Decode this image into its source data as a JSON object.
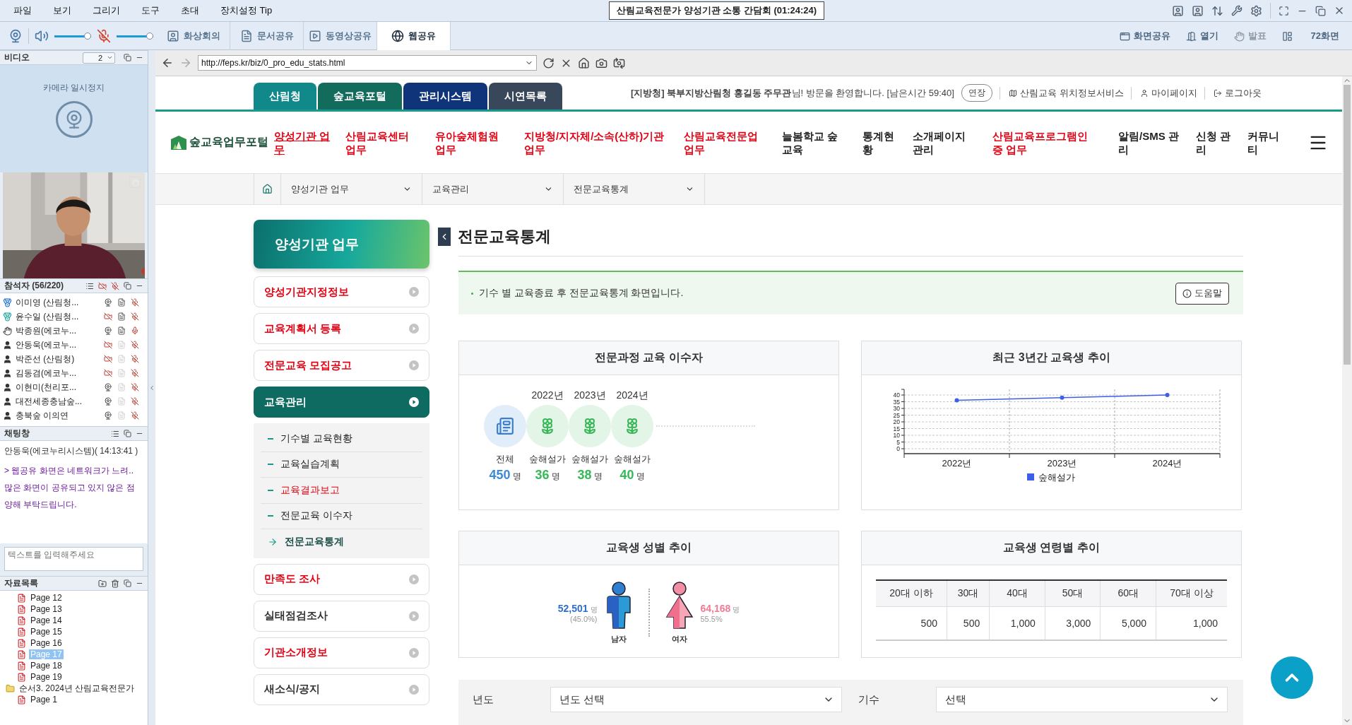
{
  "menu": [
    "파일",
    "보기",
    "그리기",
    "도구",
    "초대",
    "장치설정 Tip"
  ],
  "title": "산림교육전문가 양성기관 소통 간담회 (01:24:24)",
  "audio": {
    "speaker": {
      "level": 1
    },
    "mic": {
      "level": 1,
      "muted": true
    }
  },
  "tabs": [
    {
      "label": "화상회의",
      "kind": "person",
      "selected": false
    },
    {
      "label": "문서공유",
      "kind": "document",
      "selected": false
    },
    {
      "label": "동영상공유",
      "kind": "video",
      "selected": false
    },
    {
      "label": "웹공유",
      "kind": "web",
      "selected": true
    }
  ],
  "tools": [
    {
      "label": "화면공유",
      "kind": "screen",
      "disabled": false
    },
    {
      "label": "열기",
      "kind": "open",
      "disabled": false
    },
    {
      "label": "발표",
      "kind": "hand",
      "disabled": true
    },
    {
      "label": "72화면",
      "kind": "layout",
      "disabled": false
    }
  ],
  "video": {
    "title": "비디오",
    "count": "2",
    "camera_status": "카메라 일시정지"
  },
  "participants": {
    "title": "참석자 (56/220)",
    "items": [
      {
        "name": "이미영 (산림청...",
        "kind": "host",
        "camera": true,
        "document": true,
        "mic": false
      },
      {
        "name": "윤수일 (산림청...",
        "kind": "cohost",
        "camera": false,
        "document": true,
        "mic": false
      },
      {
        "name": "박종원(에코누...",
        "kind": "hand",
        "camera": true,
        "document": true,
        "mic": true
      },
      {
        "name": "안동욱(에코누...",
        "kind": "user",
        "camera": false,
        "document": false,
        "mic": false
      },
      {
        "name": "박준선 (산림청)",
        "kind": "user",
        "camera": false,
        "document": false,
        "mic": false
      },
      {
        "name": "김동겸(에코누...",
        "kind": "user",
        "camera": false,
        "document": false,
        "mic": false
      },
      {
        "name": "이현미(천리포...",
        "kind": "user",
        "camera": true,
        "document": false,
        "mic": false
      },
      {
        "name": "대전세종충남숲...",
        "kind": "user",
        "camera": true,
        "document": false,
        "mic": false
      },
      {
        "name": "충북숲 이의연",
        "kind": "user",
        "camera": true,
        "document": false,
        "mic": false
      }
    ]
  },
  "chat": {
    "title": "채팅창",
    "messages": [
      {
        "kind": "sender",
        "text": "안동욱(에코누리시스템)( 14:13:41 )"
      },
      {
        "kind": "message",
        "text": "> 웹공유 화면은 네트워크가 느려.. 많은 화면이 공유되고 있지 않은 점 양해 부탁드립니다."
      }
    ],
    "placeholder": "텍스트를 입력해주세요"
  },
  "documents": {
    "title": "자료목록",
    "items": [
      {
        "label": "Page 12",
        "kind": "page",
        "selected": false
      },
      {
        "label": "Page 13",
        "kind": "page",
        "selected": false
      },
      {
        "label": "Page 14",
        "kind": "page",
        "selected": false
      },
      {
        "label": "Page 15",
        "kind": "page",
        "selected": false
      },
      {
        "label": "Page 16",
        "kind": "page",
        "selected": false
      },
      {
        "label": "Page 17",
        "kind": "page",
        "selected": true
      },
      {
        "label": "Page 18",
        "kind": "page",
        "selected": false
      },
      {
        "label": "Page 19",
        "kind": "page",
        "selected": false
      },
      {
        "label": "순서3. 2024년 산림교육전문가",
        "kind": "folder",
        "selected": false,
        "children": [
          {
            "label": "Page 1",
            "kind": "page",
            "selected": false
          }
        ]
      }
    ]
  },
  "browser": {
    "url": "http://feps.kr/biz/0_pro_edu_stats.html"
  },
  "site": {
    "top_tabs": [
      {
        "label": "산림청",
        "color": "#11898a"
      },
      {
        "label": "숲교육포털",
        "color": "#136b5c"
      },
      {
        "label": "관리시스템",
        "color": "#0f3479"
      },
      {
        "label": "시연목록",
        "color": "#38475a"
      }
    ],
    "welcome": "**[지방청] 북부지방산림청 홍길동 주무관**님! 방문을 환영합니다. [남은시간 59:40]",
    "extend_button": "연장",
    "links": [
      {
        "label": "산림교육 위치정보서비스",
        "kind": "map"
      },
      {
        "label": "마이페이지",
        "kind": "user"
      },
      {
        "label": "로그아웃",
        "kind": "logout"
      }
    ],
    "logo": "숲교육업무포털",
    "nav": [
      {
        "label": "양성기관 업무",
        "color": "#e60012",
        "selected": true
      },
      {
        "label": "산림교육센터 업무",
        "color": "#e60012",
        "selected": false
      },
      {
        "label": "유아숲체험원 업무",
        "color": "#e60012",
        "selected": false
      },
      {
        "label": "지방청/지자체/소속(산하)기관 업무",
        "color": "#e60012",
        "selected": false
      },
      {
        "label": "산림교육전문업 업무",
        "color": "#e60012",
        "selected": false
      },
      {
        "label": "늘봄학교 숲교육",
        "color": "#222222",
        "selected": false
      },
      {
        "label": "통계현황",
        "color": "#222222",
        "selected": false
      },
      {
        "label": "소개페이지 관리",
        "color": "#222222",
        "selected": false
      },
      {
        "label": "산림교육프로그램인증 업무",
        "color": "#e60012",
        "selected": false
      },
      {
        "label": "알림/SMS 관리",
        "color": "#222222",
        "selected": false
      },
      {
        "label": "신청 관리",
        "color": "#222222",
        "selected": false
      },
      {
        "label": "커뮤니티",
        "color": "#222222",
        "selected": false
      }
    ],
    "breadcrumb": [
      "양성기관 업무",
      "교육관리",
      "전문교육통계"
    ],
    "sidebar": {
      "title": "양성기관 업무",
      "items": [
        {
          "label": "양성기관지정정보",
          "color": "#e60012",
          "selected": false
        },
        {
          "label": "교육계획서 등록",
          "color": "#e60012",
          "selected": false
        },
        {
          "label": "전문교육 모집공고",
          "color": "#e60012",
          "selected": false
        },
        {
          "label": "교육관리",
          "selected": true,
          "children": [
            {
              "label": "기수별 교육현황",
              "color": "#222222",
              "selected": false
            },
            {
              "label": "교육실습계획",
              "color": "#222222",
              "selected": false
            },
            {
              "label": "교육결과보고",
              "color": "#e60012",
              "selected": false
            },
            {
              "label": "전문교육 이수자",
              "color": "#222222",
              "selected": false
            },
            {
              "label": "전문교육통계",
              "color": "#1d4f4a",
              "selected": true
            }
          ]
        },
        {
          "label": "만족도 조사",
          "color": "#e60012",
          "selected": false
        },
        {
          "label": "실태점검조사",
          "color": "#333333",
          "selected": false
        },
        {
          "label": "기관소개정보",
          "color": "#e60012",
          "selected": false
        },
        {
          "label": "새소식/공지",
          "color": "#333333",
          "selected": false
        }
      ]
    },
    "page_title": "전문교육통계",
    "notice": "기수 별 교육종료 후 전문교육통계 화면입니다.",
    "help_button": "도움말",
    "completion": {
      "title": "전문과정 교육 이수자",
      "items": [
        {
          "kind": "total",
          "label": "전체",
          "value": "450",
          "unit": "명"
        },
        {
          "kind": "year",
          "year": "2022년",
          "label": "숲해설가",
          "value": "36",
          "unit": "명"
        },
        {
          "kind": "year",
          "year": "2023년",
          "label": "숲해설가",
          "value": "38",
          "unit": "명"
        },
        {
          "kind": "year",
          "year": "2024년",
          "label": "숲해설가",
          "value": "40",
          "unit": "명"
        }
      ]
    },
    "trend": {
      "title": "최근 3년간 교육생 추이",
      "chart_data": {
        "type": "line",
        "categories": [
          "2022년",
          "2023년",
          "2024년"
        ],
        "series": [
          {
            "name": "숲해설가",
            "color": "#3d5ee6",
            "marker": "circle",
            "values": [
              36,
              38,
              40
            ]
          }
        ],
        "grid": true,
        "ylim": [
          0,
          40
        ],
        "yticks": [
          0,
          5,
          10,
          15,
          20,
          25,
          30,
          35,
          40
        ]
      }
    },
    "gender": {
      "title": "교육생 성별 추이",
      "items": [
        {
          "kind": "male",
          "label": "남자",
          "value": "52,501",
          "unit": "명",
          "share": "(45.0%)"
        },
        {
          "kind": "female",
          "label": "여자",
          "value": "64,168",
          "unit": "명",
          "share": "55.5%"
        }
      ]
    },
    "age": {
      "title": "교육생 연령별 추이",
      "columns": [
        "20대 이하",
        "30대",
        "40대",
        "50대",
        "60대",
        "70대 이상"
      ],
      "rows": [
        [
          "500",
          "500",
          "1,000",
          "3,000",
          "5,000",
          "1,000"
        ]
      ]
    },
    "filters": [
      {
        "label": "년도",
        "value": "년도 선택"
      },
      {
        "label": "기수",
        "value": "선택"
      }
    ]
  }
}
